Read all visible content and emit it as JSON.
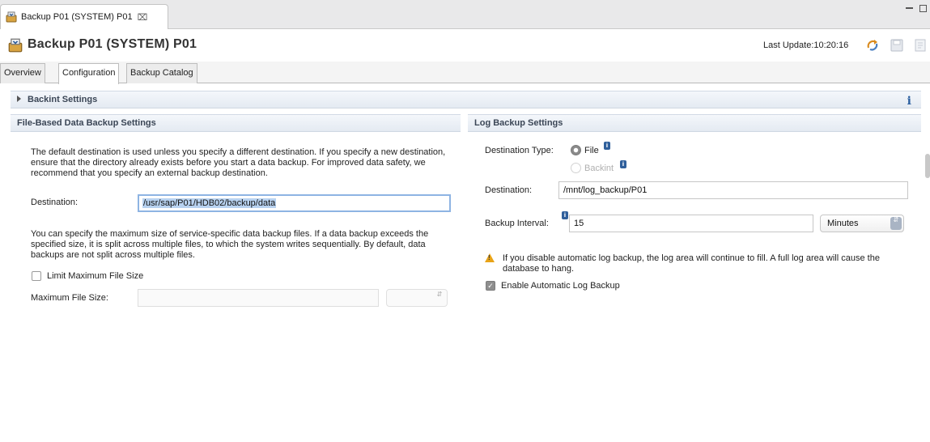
{
  "editor_tab": {
    "label": "Backup P01 (SYSTEM) P01",
    "close_glyph": "⌧"
  },
  "header": {
    "title": "Backup P01 (SYSTEM) P01",
    "last_update": "Last Update:10:20:16"
  },
  "subtabs": [
    {
      "label": "Overview"
    },
    {
      "label": "Configuration"
    },
    {
      "label": "Backup Catalog"
    }
  ],
  "active_subtab": "Configuration",
  "backint": {
    "title": "Backint Settings",
    "info_glyph": "i"
  },
  "file_backup": {
    "title": "File-Based Data Backup Settings",
    "description": "The default destination is used unless you specify a different destination. If you specify a new destination, ensure that the directory already exists before you start a data backup. For improved data safety, we recommend that you specify an external backup destination.",
    "destination_label": "Destination:",
    "destination_value": "/usr/sap/P01/HDB02/backup/data",
    "size_description": "You can specify the maximum size of service-specific data backup files. If a data backup exceeds the specified size, it is split across multiple files, to which the system writes sequentially. By default, data backups are not split across multiple files.",
    "limit_label": "Limit Maximum File Size",
    "limit_checked": false,
    "max_size_label": "Maximum File Size:",
    "max_size_value": "",
    "unit_value": ""
  },
  "log_backup": {
    "title": "Log Backup Settings",
    "dest_type_label": "Destination Type:",
    "option_file": "File",
    "option_backint": "Backint",
    "selected_type": "File",
    "destination_label": "Destination:",
    "destination_value": "/mnt/log_backup/P01",
    "interval_label": "Backup Interval:",
    "interval_value": "15",
    "interval_unit": "Minutes",
    "warning": "If you disable automatic log backup, the log area will continue to fill. A full log area will cause the database to hang.",
    "enable_label": "Enable Automatic Log Backup",
    "enable_checked": true
  },
  "colors": {
    "section_header": "#e4eaf2",
    "accent": "#2f5f9b",
    "warning": "#e8a317",
    "selection": "#b8d2f0"
  }
}
